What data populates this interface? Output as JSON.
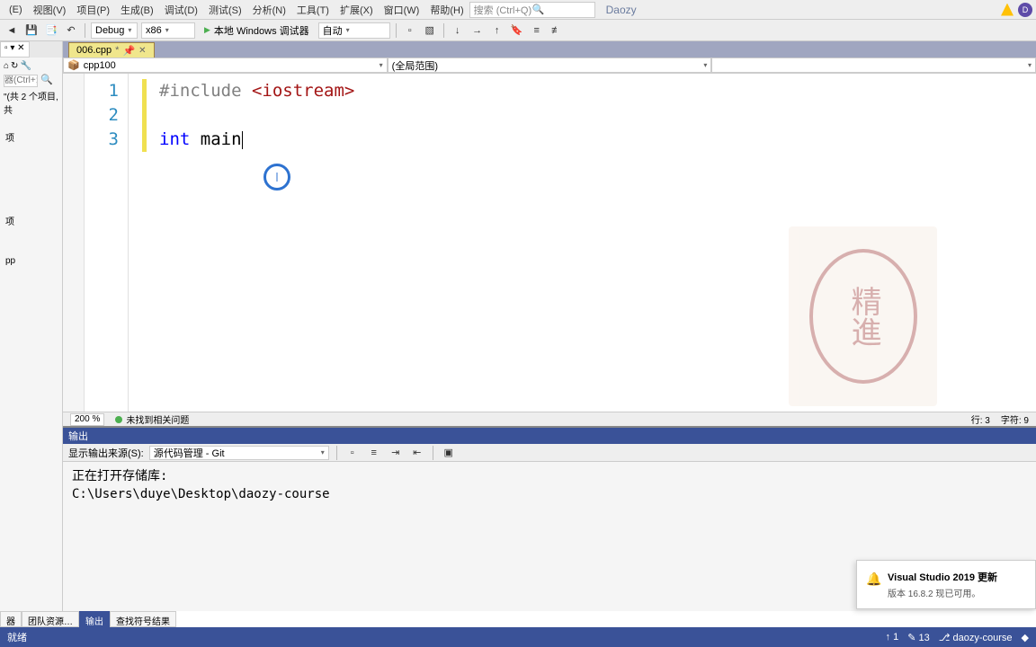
{
  "menu": {
    "items": [
      "(E)",
      "视图(V)",
      "项目(P)",
      "生成(B)",
      "调试(D)",
      "测试(S)",
      "分析(N)",
      "工具(T)",
      "扩展(X)",
      "窗口(W)",
      "帮助(H)"
    ],
    "search_placeholder": "搜索 (Ctrl+Q)",
    "app": "Daozy",
    "avatar_letter": "D"
  },
  "toolbar": {
    "config": "Debug",
    "platform": "x86",
    "target": "本地 Windows 调试器",
    "auto": "自动"
  },
  "sidebar": {
    "search_placeholder": "器(Ctrl+;)",
    "solution_line": "\"(共 2 个项目, 共",
    "items": [
      "项",
      "项",
      "pp"
    ]
  },
  "tabs": {
    "active_file": "006.cpp",
    "dirty_marker": "*"
  },
  "nav": {
    "left": "cpp100",
    "right": "(全局范围)"
  },
  "code": {
    "lines": [
      {
        "num": "1",
        "tokens": [
          {
            "t": "directive",
            "v": "#include"
          },
          {
            "t": "space",
            "v": " "
          },
          {
            "t": "string",
            "v": "<iostream>"
          }
        ]
      },
      {
        "num": "2",
        "tokens": []
      },
      {
        "num": "3",
        "tokens": [
          {
            "t": "keyword",
            "v": "int"
          },
          {
            "t": "space",
            "v": " "
          },
          {
            "t": "ident",
            "v": "main"
          }
        ],
        "cursor": true
      }
    ]
  },
  "stamp_text": "精進",
  "editor_status": {
    "zoom": "200 %",
    "issues": "未找到相关问题",
    "line_col": "行: 3",
    "chars": "字符: 9"
  },
  "output": {
    "title": "输出",
    "source_label": "显示输出来源(S):",
    "source_value": "源代码管理 - Git",
    "line1": "正在打开存储库:",
    "line2": "C:\\Users\\duye\\Desktop\\daozy-course"
  },
  "bottom_tabs": [
    "器",
    "团队资源…",
    "输出",
    "查找符号结果"
  ],
  "statusbar": {
    "ready": "就绪",
    "git_up": "1",
    "git_changes": "13",
    "repo": "daozy-course"
  },
  "notification": {
    "title": "Visual Studio 2019 更新",
    "desc": "版本 16.8.2 现已可用。"
  }
}
